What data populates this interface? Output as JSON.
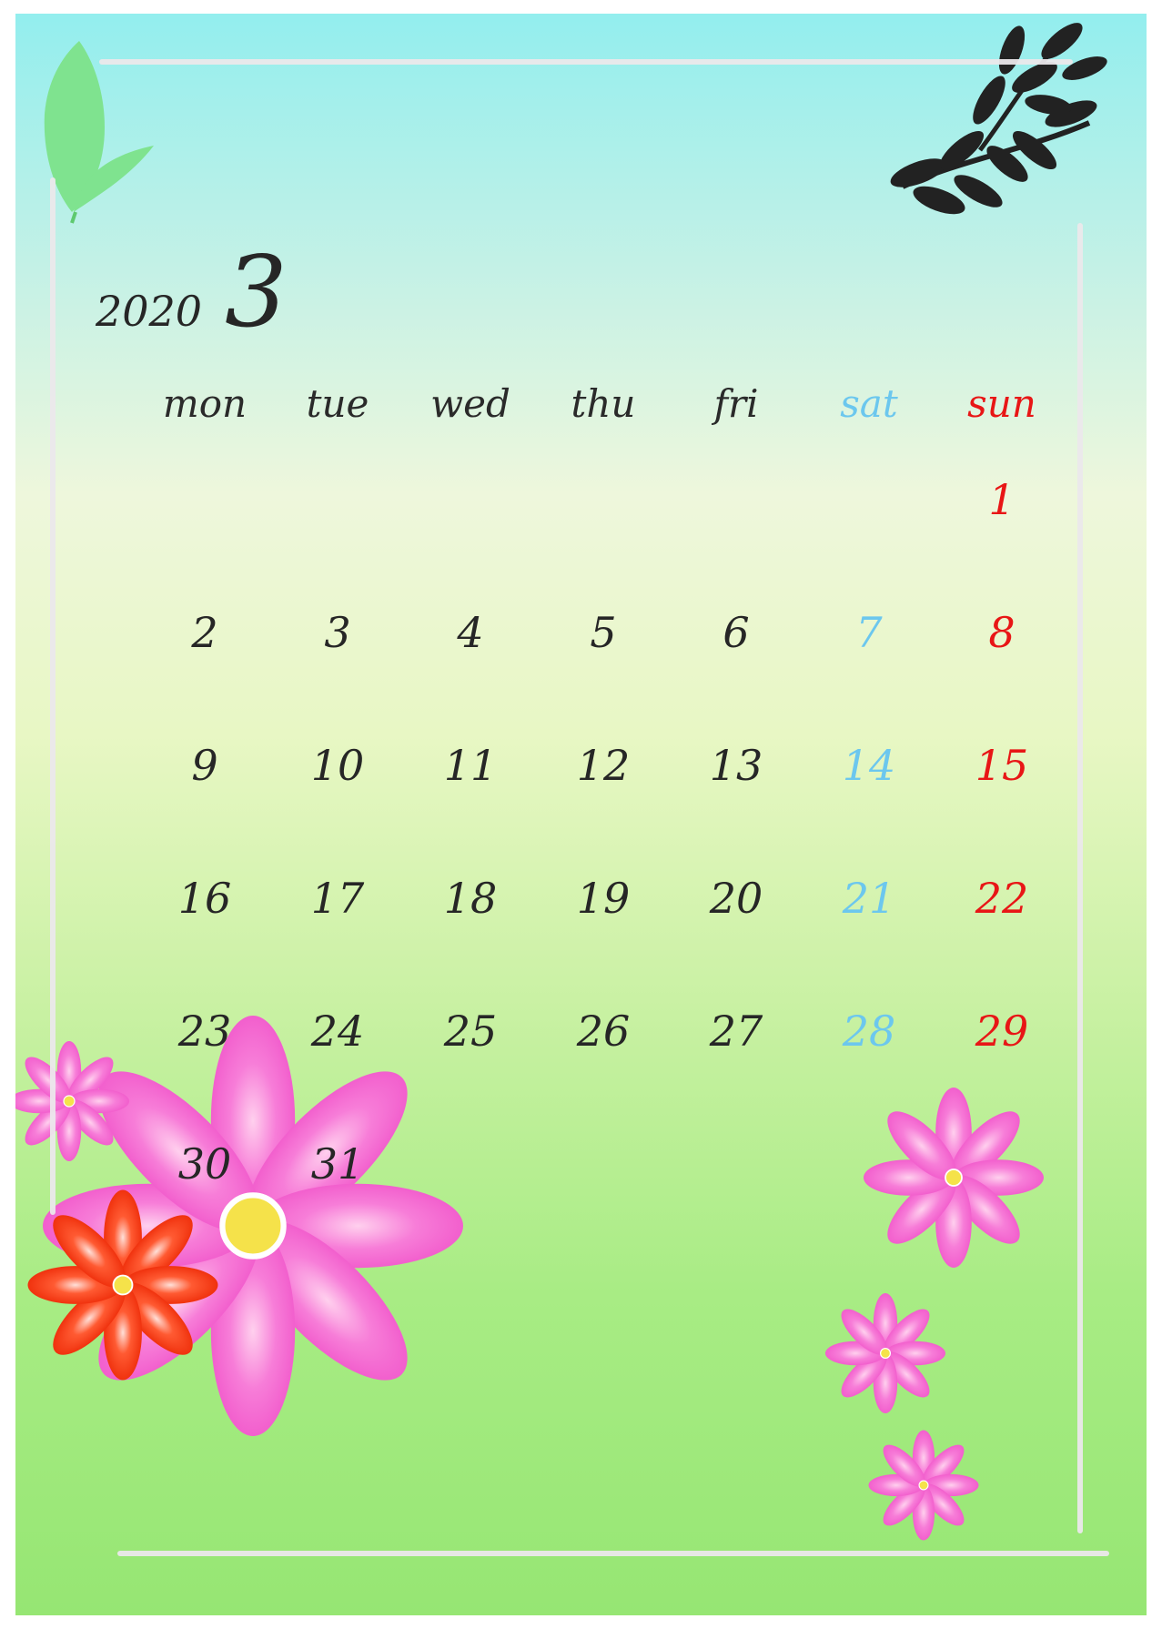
{
  "calendar": {
    "year": "2020",
    "month": "3",
    "weekdays": [
      "mon",
      "tue",
      "wed",
      "thu",
      "fri",
      "sat",
      "sun"
    ],
    "weeks": [
      [
        "",
        "",
        "",
        "",
        "",
        "",
        "1"
      ],
      [
        "2",
        "3",
        "4",
        "5",
        "6",
        "7",
        "8"
      ],
      [
        "9",
        "10",
        "11",
        "12",
        "13",
        "14",
        "15"
      ],
      [
        "16",
        "17",
        "18",
        "19",
        "20",
        "21",
        "22"
      ],
      [
        "23",
        "24",
        "25",
        "26",
        "27",
        "28",
        "29"
      ],
      [
        "30",
        "31",
        "",
        "",
        "",
        "",
        ""
      ]
    ]
  },
  "colors": {
    "text": "#262626",
    "saturday": "#6cc7ee",
    "sunday": "#e81616",
    "frame": "#ebe8eb"
  }
}
